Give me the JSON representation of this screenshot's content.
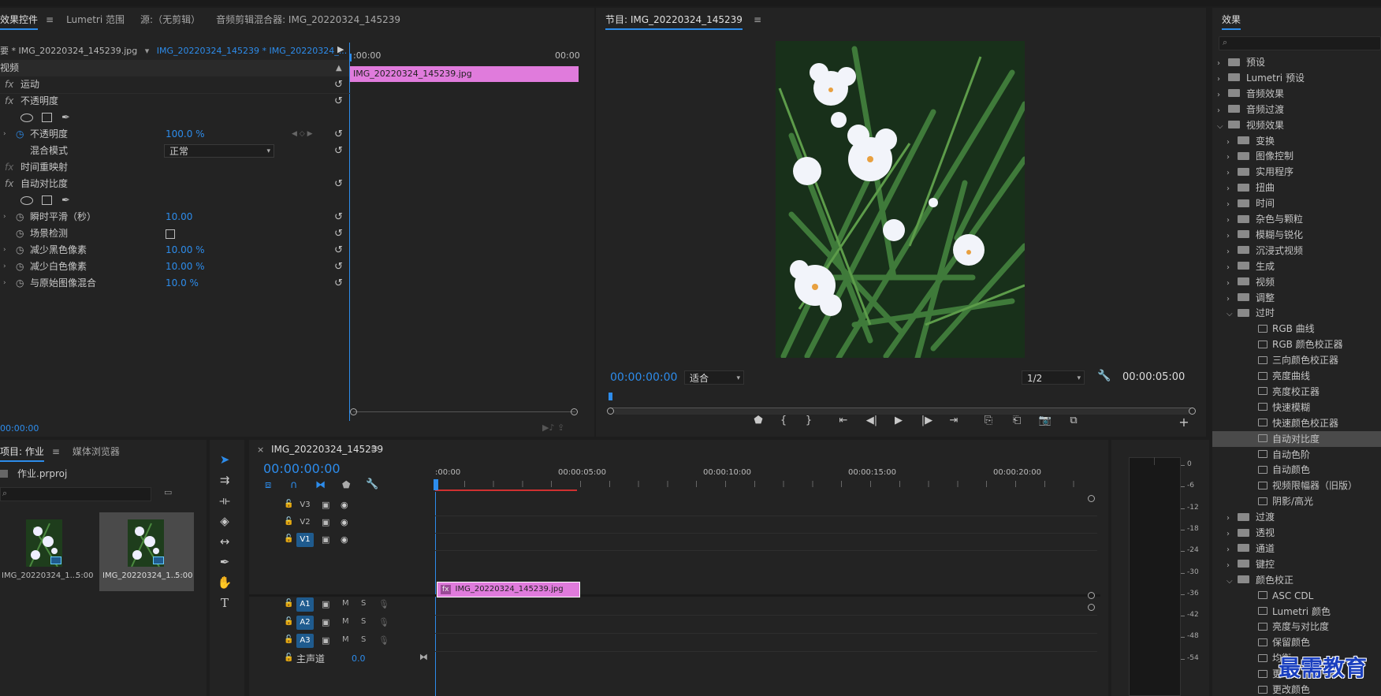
{
  "top_strip": {},
  "effect_controls": {
    "tabs": [
      {
        "label": "效果控件",
        "active": true
      },
      {
        "label": "Lumetri 范围",
        "active": false
      },
      {
        "label": "源:（无剪辑）",
        "active": false
      },
      {
        "label": "音频剪辑混合器: IMG_20220324_145239",
        "active": false
      }
    ],
    "menu_icon": "hamburger-icon",
    "source_label": "要 * IMG_20220324_145239.jpg",
    "sequence_label": "IMG_20220324_145239 * IMG_20220324_...",
    "section_video": "视频",
    "mini_timeline": {
      "start": ":00:00",
      "end": "00:00",
      "clip": "IMG_20220324_145239.jpg"
    },
    "rows": [
      {
        "fx": "fx",
        "name": "运动"
      },
      {
        "fx": "fx",
        "name": "不透明度"
      },
      {
        "name": "不透明度",
        "value": "100.0 %"
      },
      {
        "name": "混合模式",
        "value": "正常"
      },
      {
        "fx": "fx",
        "name": "时间重映射"
      },
      {
        "fx": "fx",
        "name": "自动对比度"
      },
      {
        "name": "瞬时平滑（秒）",
        "value": "10.00"
      },
      {
        "name": "场景检测"
      },
      {
        "name": "减少黑色像素",
        "value": "10.00 %"
      },
      {
        "name": "减少白色像素",
        "value": "10.00 %"
      },
      {
        "name": "与原始图像混合",
        "value": "10.0 %"
      }
    ],
    "timecode": "00:00:00"
  },
  "program_monitor": {
    "title": "节目: IMG_20220324_145239",
    "timecode_current": "00:00:00:00",
    "fit_label": "适合",
    "resolution": "1/2",
    "timecode_duration": "00:00:05:00"
  },
  "effects_panel": {
    "title": "效果",
    "items": [
      {
        "label": "预设",
        "level": 0,
        "type": "folder",
        "open": false
      },
      {
        "label": "Lumetri 预设",
        "level": 0,
        "type": "folder",
        "open": false
      },
      {
        "label": "音频效果",
        "level": 0,
        "type": "folder",
        "open": false
      },
      {
        "label": "音频过渡",
        "level": 0,
        "type": "folder",
        "open": false
      },
      {
        "label": "视频效果",
        "level": 0,
        "type": "folder",
        "open": true
      },
      {
        "label": "变换",
        "level": 1,
        "type": "folder",
        "open": false
      },
      {
        "label": "图像控制",
        "level": 1,
        "type": "folder",
        "open": false
      },
      {
        "label": "实用程序",
        "level": 1,
        "type": "folder",
        "open": false
      },
      {
        "label": "扭曲",
        "level": 1,
        "type": "folder",
        "open": false
      },
      {
        "label": "时间",
        "level": 1,
        "type": "folder",
        "open": false
      },
      {
        "label": "杂色与颗粒",
        "level": 1,
        "type": "folder",
        "open": false
      },
      {
        "label": "模糊与锐化",
        "level": 1,
        "type": "folder",
        "open": false
      },
      {
        "label": "沉浸式视频",
        "level": 1,
        "type": "folder",
        "open": false
      },
      {
        "label": "生成",
        "level": 1,
        "type": "folder",
        "open": false
      },
      {
        "label": "视频",
        "level": 1,
        "type": "folder",
        "open": false
      },
      {
        "label": "调整",
        "level": 1,
        "type": "folder",
        "open": false
      },
      {
        "label": "过时",
        "level": 1,
        "type": "folder",
        "open": true
      },
      {
        "label": "RGB 曲线",
        "level": 2,
        "type": "effect"
      },
      {
        "label": "RGB 颜色校正器",
        "level": 2,
        "type": "effect"
      },
      {
        "label": "三向颜色校正器",
        "level": 2,
        "type": "effect"
      },
      {
        "label": "亮度曲线",
        "level": 2,
        "type": "effect"
      },
      {
        "label": "亮度校正器",
        "level": 2,
        "type": "effect"
      },
      {
        "label": "快速模糊",
        "level": 2,
        "type": "effect"
      },
      {
        "label": "快速颜色校正器",
        "level": 2,
        "type": "effect"
      },
      {
        "label": "自动对比度",
        "level": 2,
        "type": "effect",
        "selected": true
      },
      {
        "label": "自动色阶",
        "level": 2,
        "type": "effect"
      },
      {
        "label": "自动颜色",
        "level": 2,
        "type": "effect"
      },
      {
        "label": "视频限幅器（旧版）",
        "level": 2,
        "type": "effect"
      },
      {
        "label": "阴影/高光",
        "level": 2,
        "type": "effect"
      },
      {
        "label": "过渡",
        "level": 1,
        "type": "folder",
        "open": false
      },
      {
        "label": "透视",
        "level": 1,
        "type": "folder",
        "open": false
      },
      {
        "label": "通道",
        "level": 1,
        "type": "folder",
        "open": false
      },
      {
        "label": "键控",
        "level": 1,
        "type": "folder",
        "open": false
      },
      {
        "label": "颜色校正",
        "level": 1,
        "type": "folder",
        "open": true
      },
      {
        "label": "ASC CDL",
        "level": 2,
        "type": "effect"
      },
      {
        "label": "Lumetri 颜色",
        "level": 2,
        "type": "effect"
      },
      {
        "label": "亮度与对比度",
        "level": 2,
        "type": "effect"
      },
      {
        "label": "保留颜色",
        "level": 2,
        "type": "effect"
      },
      {
        "label": "均衡",
        "level": 2,
        "type": "effect"
      },
      {
        "label": "更改",
        "level": 2,
        "type": "effect"
      },
      {
        "label": "更改颜色",
        "level": 2,
        "type": "effect"
      }
    ]
  },
  "project_panel": {
    "tabs": [
      {
        "label": "项目: 作业",
        "active": true
      },
      {
        "label": "媒体浏览器",
        "active": false
      }
    ],
    "file": "作业.prproj",
    "items": [
      {
        "name": "IMG_20220324_1...",
        "duration": "5:00"
      },
      {
        "name": "IMG_20220324_1...",
        "duration": "5:00"
      }
    ]
  },
  "timeline": {
    "title": "IMG_20220324_145239",
    "timecode": "00:00:00:00",
    "ruler": [
      ":00:00",
      "00:00:05:00",
      "00:00:10:00",
      "00:00:15:00",
      "00:00:20:00"
    ],
    "tracks_video": [
      "V3",
      "V2",
      "V1"
    ],
    "tracks_audio": [
      "A1",
      "A2",
      "A3"
    ],
    "master_label": "主声道",
    "master_value": "0.0",
    "clip": "IMG_20220324_145239.jpg",
    "clip_fx": "fx",
    "audio_m": "M",
    "audio_s": "S"
  },
  "meter": {
    "scale": [
      "0",
      "-6",
      "-12",
      "-18",
      "-24",
      "-30",
      "-36",
      "-42",
      "-48",
      "-54"
    ]
  },
  "watermark": "最需教育",
  "colors": {
    "accent": "#2d8ceb",
    "clip_pink": "#e07bdc",
    "bg": "#232323",
    "track_blue": "#1f5b8e"
  }
}
